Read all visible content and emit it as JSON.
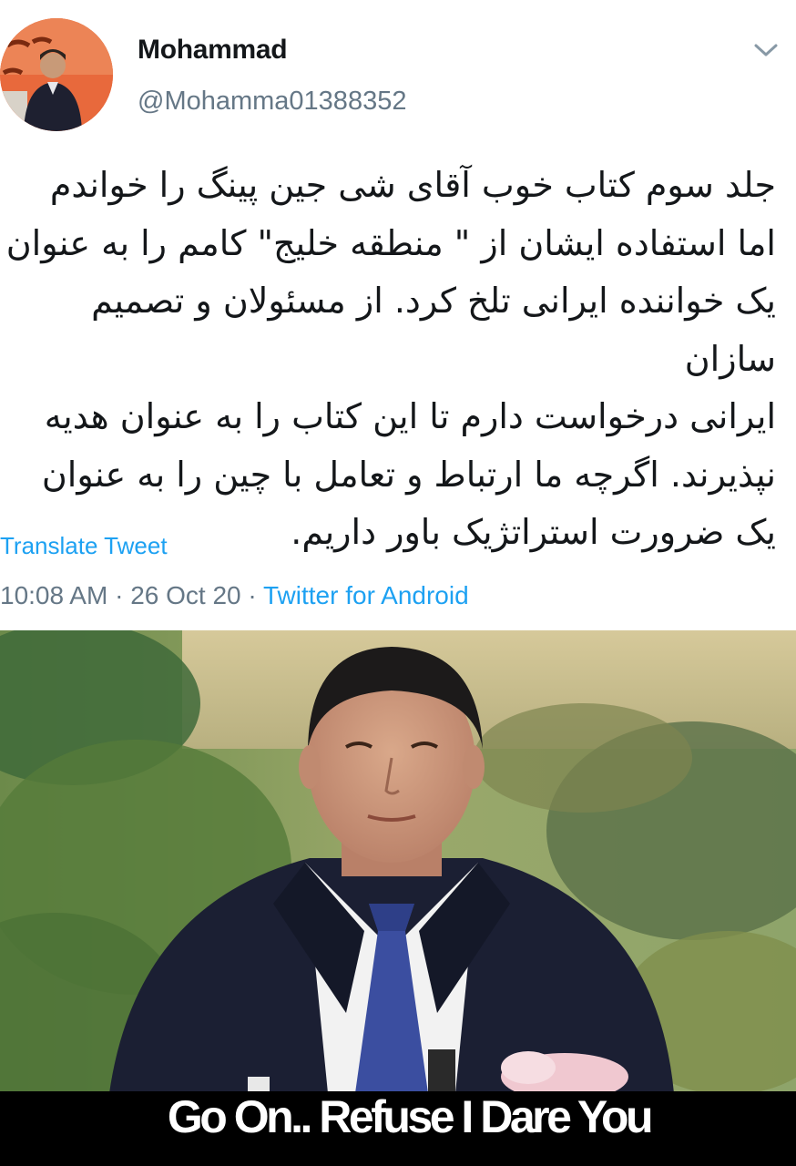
{
  "tweet": {
    "author": {
      "display_name": "Mohammad",
      "handle": "@Mohamma01388352",
      "avatar_icon": "user-avatar-photo"
    },
    "menu_icon": "chevron-down-icon",
    "text": "جلد سوم کتاب خوب آقای شی جین پینگ را خواندم\nاما استفاده ایشان از \" منطقه خلیج\" کامم را به عنوان\nیک خواننده ایرانی تلخ کرد. از مسئولان و تصمیم سازان\nایرانی درخواست دارم تا این کتاب را به عنوان هدیه\nنپذیرند. اگرچه ما ارتباط و تعامل با چین را به عنوان\nیک ضرورت استراتژیک باور داریم.",
    "translate_label": "Translate Tweet",
    "time": "10:08 AM",
    "date": "26 Oct 20",
    "separator": "·",
    "source": "Twitter for Android"
  },
  "meme": {
    "caption": "Go On.. Refuse I Dare You"
  },
  "colors": {
    "link": "#1da1f2",
    "secondary_text": "#657786",
    "primary_text": "#14171a",
    "caption_bar": "#000000"
  }
}
